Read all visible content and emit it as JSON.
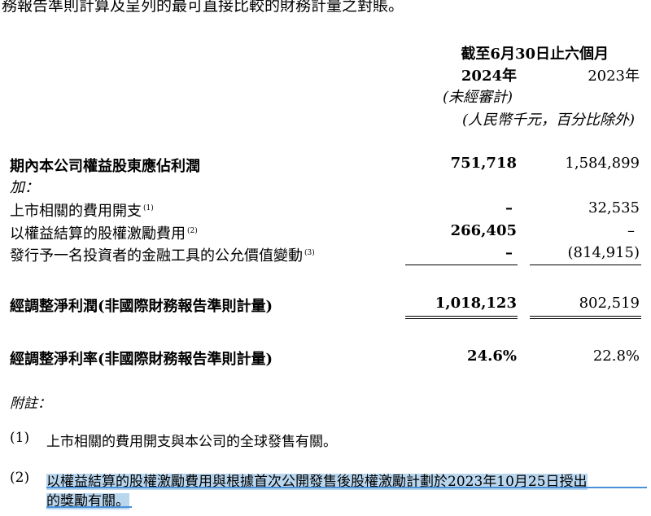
{
  "intro_text": "務報告準則計算及呈列的最可直接比較的財務計量之對賬。",
  "header": {
    "period": "截至6月30日止六個月",
    "year_2024": "2024年",
    "year_2023": "2023年",
    "unaudited": "(未經審計)",
    "unit": "(人民幣千元，百分比除外)"
  },
  "rows": {
    "profit": {
      "label": "期內本公司權益股東應佔利潤",
      "v2024": "751,718",
      "v2023": "1,584,899"
    },
    "add": {
      "label": "加："
    },
    "listing": {
      "label": "上市相關的費用開支",
      "note": "(1)",
      "v2024": "–",
      "v2023": "32,535"
    },
    "share_comp": {
      "label": "以權益結算的股權激勵費用",
      "note": "(2)",
      "v2024": "266,405",
      "v2023": "–"
    },
    "fair_value": {
      "label": "發行予一名投資者的金融工具的公允價值變動",
      "note": "(3)",
      "v2024": "–",
      "v2023": "(814,915)"
    },
    "adj_profit": {
      "label": "經調整淨利潤(非國際財務報告準則計量)",
      "v2024": "1,018,123",
      "v2023": "802,519"
    },
    "adj_margin": {
      "label": "經調整淨利率(非國際財務報告準則計量)",
      "v2024": "24.6%",
      "v2023": "22.8%"
    }
  },
  "notes": {
    "title": "附註：",
    "n1_num": "(1)",
    "n1_text": "上市相關的費用開支與本公司的全球發售有關。",
    "n2_num": "(2)",
    "n2_line1": "以權益結算的股權激勵費用與根據首次公開發售後股權激勵計劃於2023年10月25日授出",
    "n2_line2": "的獎勵有關。"
  },
  "colors": {
    "highlight": "#b9d6ef",
    "highlight_border": "#4a90d9"
  }
}
